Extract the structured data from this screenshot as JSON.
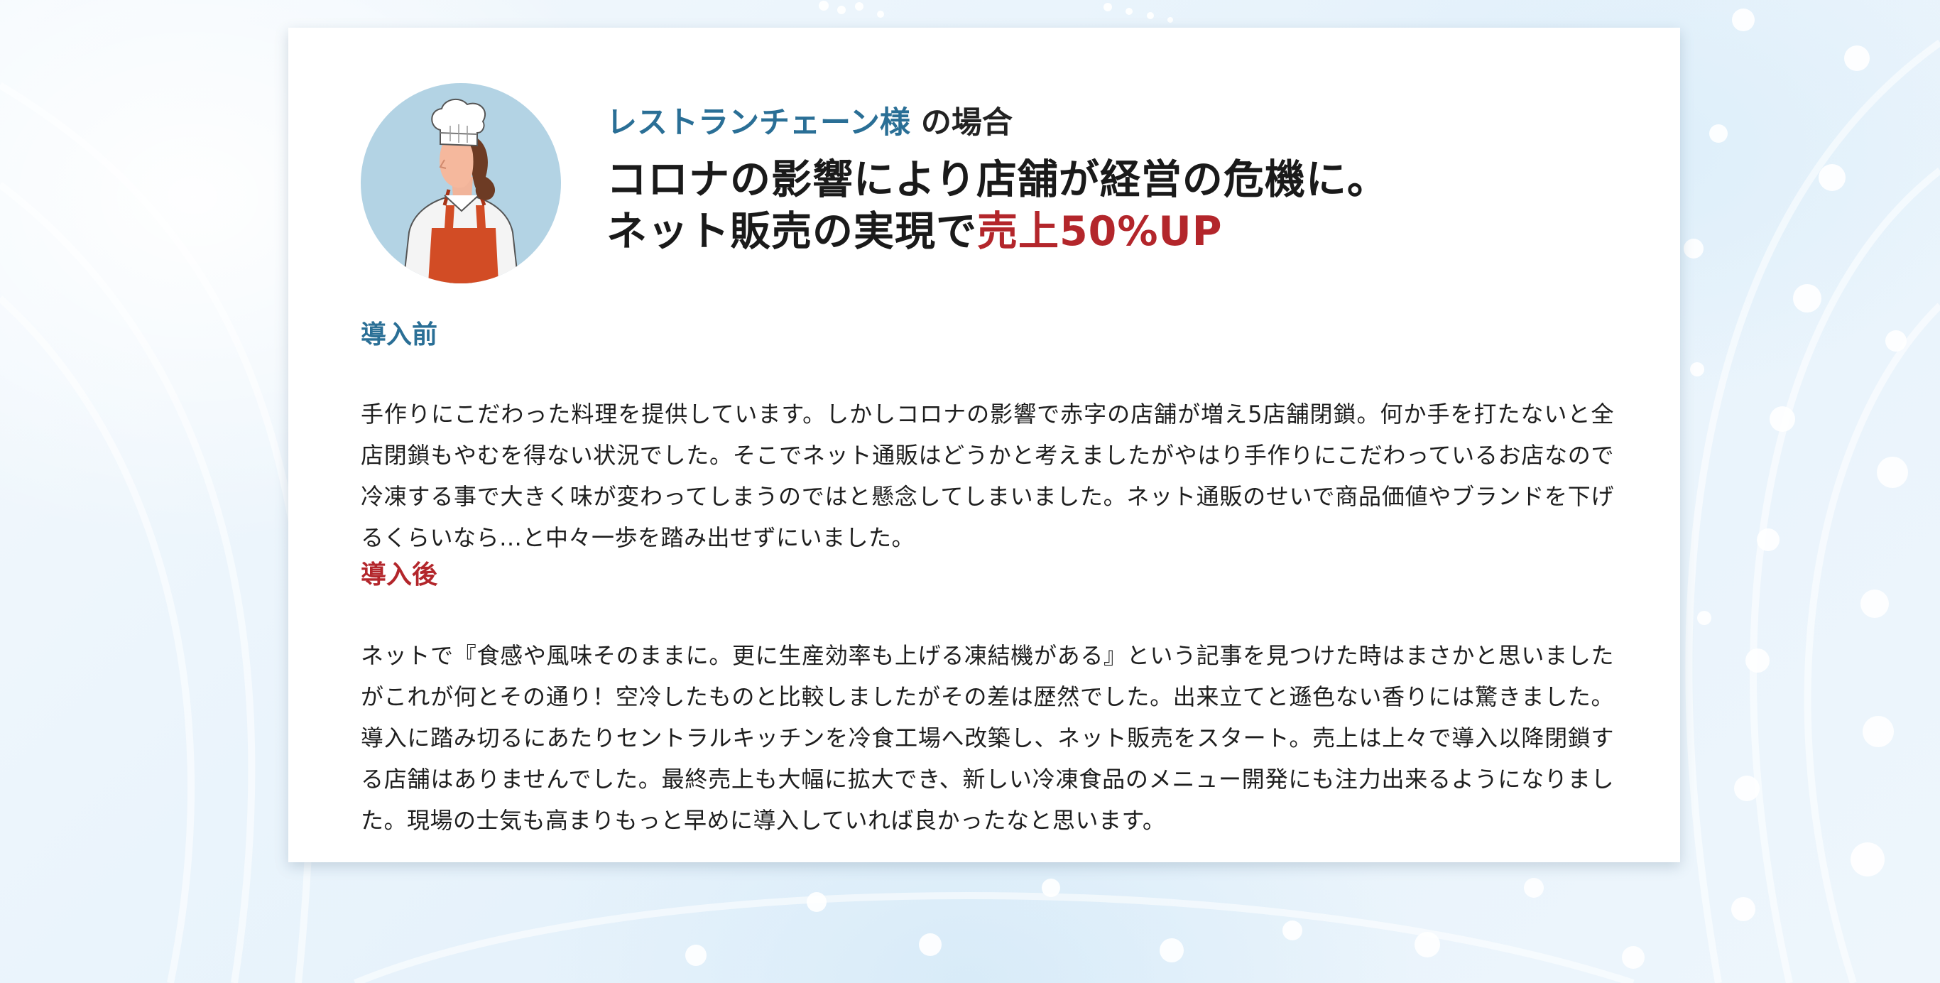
{
  "case": {
    "company": "レストランチェーン様",
    "company_suffix": " の場合",
    "title_line1": "コロナの影響により店舗が経営の危機に。",
    "title_line2_prefix": "ネット販売の実現で",
    "title_line2_highlight": "売上50%UP"
  },
  "before": {
    "label": "導入前",
    "text": "手作りにこだわった料理を提供しています。しかしコロナの影響で赤字の店舗が増え5店舗閉鎖。何か手を打たないと全店閉鎖もやむを得ない状況でした。そこでネット通販はどうかと考えましたがやはり手作りにこだわっているお店なので冷凍する事で大きく味が変わってしまうのではと懸念してしまいました。ネット通販のせいで商品価値やブランドを下げるくらいなら…と中々一歩を踏み出せずにいました。"
  },
  "after": {
    "label": "導入後",
    "text": "ネットで『食感や風味そのままに。更に生産効率も上げる凍結機がある』という記事を見つけた時はまさかと思いましたがこれが何とその通り！空冷したものと比較しましたがその差は歴然でした。出来立てと遜色ない香りには驚きました。導入に踏み切るにあたりセントラルキッチンを冷食工場へ改築し、ネット販売をスタート。売上は上々で導入以降閉鎖する店舗はありませんでした。最終売上も大幅に拡大でき、新しい冷凍食品のメニュー開発にも注力出来るようになりました。現場の士気も高まりもっと早めに導入していれば良かったなと思います。"
  },
  "colors": {
    "accent_blue": "#2a6f96",
    "accent_red": "#b3262b",
    "avatar_bg": "#b3d3e4"
  },
  "avatar_icon": "chef-illustration"
}
